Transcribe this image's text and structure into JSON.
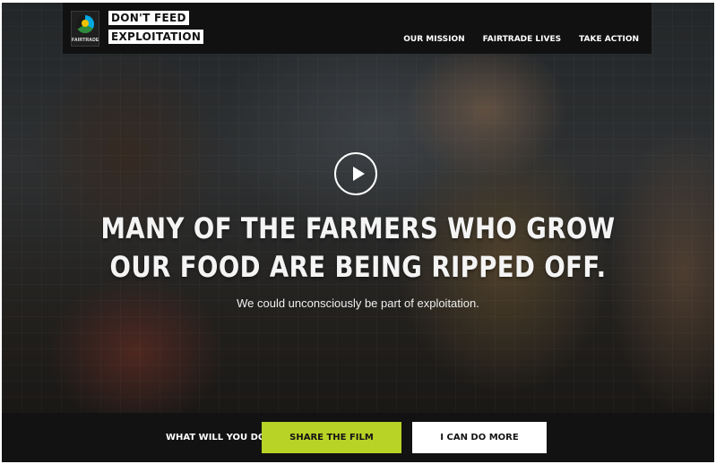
{
  "header": {
    "logo_text": "FAIRTRADE",
    "brand_line1": "DON'T FEED",
    "brand_line2": "EXPLOITATION",
    "nav": [
      "OUR MISSION",
      "FAIRTRADE LIVES",
      "TAKE ACTION"
    ]
  },
  "hero": {
    "headline_line1": "MANY OF THE FARMERS WHO GROW",
    "headline_line2": "OUR FOOD ARE BEING RIPPED OFF.",
    "subtitle": "We could unconsciously be part of exploitation."
  },
  "cta": {
    "question": "WHAT WILL YOU DO?",
    "share_label": "SHARE THE FILM",
    "more_label": "I CAN DO MORE"
  },
  "colors": {
    "accent": "#b9d226",
    "bar": "#111111"
  }
}
